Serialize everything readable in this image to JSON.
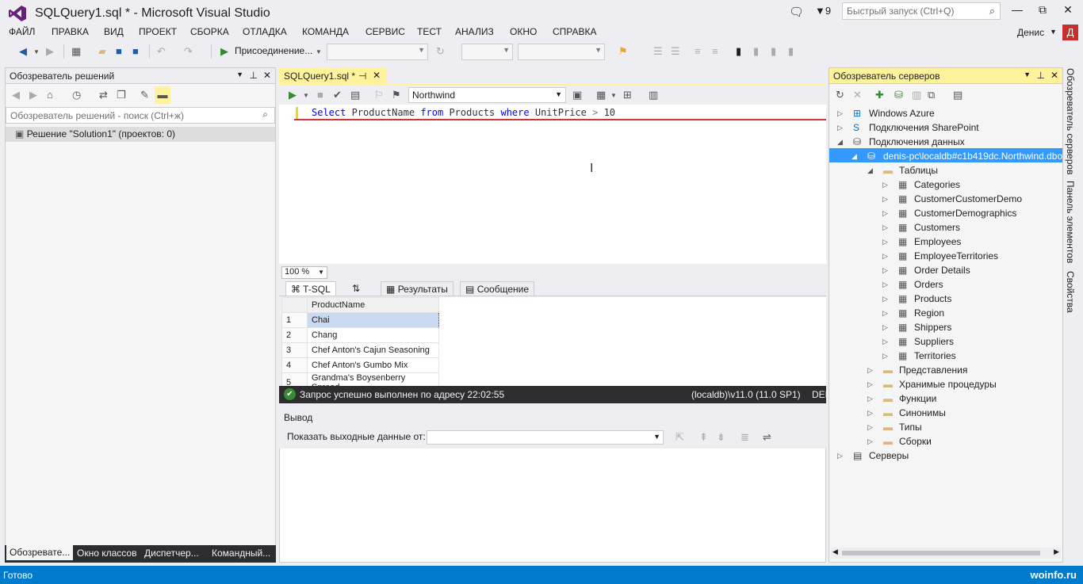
{
  "window": {
    "title": "SQLQuery1.sql * - Microsoft Visual Studio",
    "notification_count": "9",
    "quick_launch_placeholder": "Быстрый запуск (Ctrl+Q)",
    "minimize": "—",
    "maximize": "⧉",
    "close": "✕"
  },
  "menu": {
    "items": [
      "ФАЙЛ",
      "ПРАВКА",
      "ВИД",
      "ПРОЕКТ",
      "СБОРКА",
      "ОТЛАДКА",
      "КОМАНДА",
      "СЕРВИС",
      "ТЕСТ",
      "АНАЛИЗ",
      "ОКНО",
      "СПРАВКА"
    ],
    "user_name": "Денис",
    "user_initial": "Д"
  },
  "toolbar": {
    "attach_label": "Присоединение..."
  },
  "solution_explorer": {
    "title": "Обозреватель решений",
    "search_placeholder": "Обозреватель решений - поиск (Ctrl+ж)",
    "solution_item": "Решение \"Solution1\"  (проектов: 0)",
    "tabs": [
      "Обозревате...",
      "Окно классов",
      "Диспетчер...",
      "Командный..."
    ]
  },
  "editor": {
    "tab_label": "SQLQuery1.sql *",
    "database": "Northwind",
    "code": {
      "select": "Select",
      "column": "ProductName",
      "from": "from",
      "table": "Products",
      "where": "where",
      "field": "UnitPrice",
      "op": ">",
      "value": "10"
    },
    "zoom": "100 %",
    "tsql_tab": "T-SQL",
    "results_tab": "Результаты",
    "message_tab": "Сообщение"
  },
  "results": {
    "column": "ProductName",
    "rows": [
      {
        "num": "1",
        "value": "Chai"
      },
      {
        "num": "2",
        "value": "Chang"
      },
      {
        "num": "3",
        "value": "Chef Anton's Cajun Seasoning"
      },
      {
        "num": "4",
        "value": "Chef Anton's Gumbo Mix"
      },
      {
        "num": "5",
        "value": "Grandma's Boysenberry Spread"
      }
    ],
    "status": "Запрос успешно выполнен по адресу 22:02:55",
    "server": "(localdb)\\v11.0 (11.0 SP1)",
    "user_short": "DEN"
  },
  "output": {
    "title": "Вывод",
    "show_from_label": "Показать выходные данные от:"
  },
  "server_explorer": {
    "title": "Обозреватель серверов",
    "nodes": {
      "azure": "Windows Azure",
      "sharepoint": "Подключения SharePoint",
      "data_connections": "Подключения данных",
      "connection": "denis-pc\\localdb#c1b419dc.Northwind.dbo",
      "tables_folder": "Таблицы",
      "tables": [
        "Categories",
        "CustomerCustomerDemo",
        "CustomerDemographics",
        "Customers",
        "Employees",
        "EmployeeTerritories",
        "Order Details",
        "Orders",
        "Products",
        "Region",
        "Shippers",
        "Suppliers",
        "Territories"
      ],
      "folders": [
        "Представления",
        "Хранимые процедуры",
        "Функции",
        "Синонимы",
        "Типы",
        "Сборки"
      ],
      "servers": "Серверы"
    },
    "side_tabs": [
      "Обозреватель серверов",
      "Панель элементов",
      "Свойства"
    ]
  },
  "statusbar": {
    "text": "Готово",
    "watermark": "woinfo.ru"
  },
  "colors": {
    "accent": "#007acc",
    "active_tab": "#fff29d",
    "selection": "#3399ff",
    "error_line": "#d13438"
  }
}
